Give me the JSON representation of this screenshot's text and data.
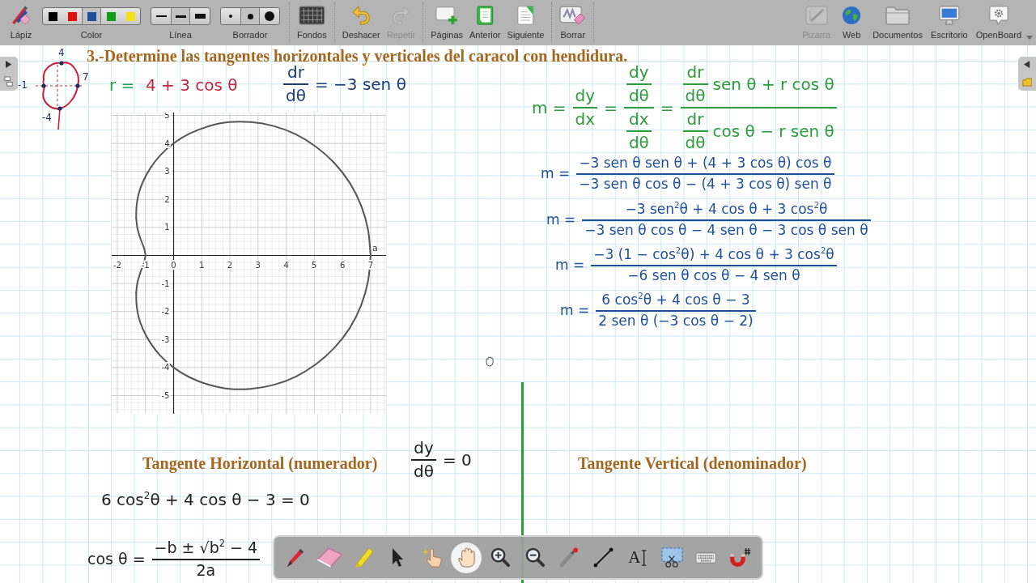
{
  "toolbar": {
    "left": [
      {
        "kind": "tool",
        "label": "Lápiz",
        "disabled": false
      },
      {
        "kind": "colors",
        "label": "Color",
        "disabled": false,
        "swatches": [
          {
            "color": "#000000",
            "selected": false
          },
          {
            "color": "#e01010",
            "selected": false
          },
          {
            "color": "#1f4f9a",
            "selected": true
          },
          {
            "color": "#159c1a",
            "selected": false
          },
          {
            "color": "#f2e21a",
            "selected": false
          }
        ]
      },
      {
        "kind": "widths",
        "label": "Línea",
        "disabled": false,
        "options": [
          {
            "selected": false
          },
          {
            "selected": true
          },
          {
            "selected": false
          }
        ]
      },
      {
        "kind": "erasers",
        "label": "Borrador",
        "disabled": false,
        "options": [
          {
            "selected": false
          },
          {
            "selected": true
          },
          {
            "selected": false
          }
        ]
      },
      {
        "kind": "tool",
        "label": "Fondos",
        "disabled": false
      },
      {
        "kind": "tool",
        "label": "Deshacer",
        "disabled": false
      },
      {
        "kind": "tool",
        "label": "Repetir",
        "disabled": true
      },
      {
        "kind": "tool",
        "label": "Páginas",
        "disabled": false
      },
      {
        "kind": "tool",
        "label": "Anterior",
        "disabled": false
      },
      {
        "kind": "tool",
        "label": "Siguiente",
        "disabled": false
      },
      {
        "kind": "tool",
        "label": "Borrar",
        "disabled": false
      }
    ],
    "right": [
      {
        "label": "Pizarra",
        "disabled": true
      },
      {
        "label": "Web",
        "disabled": false
      },
      {
        "label": "Documentos",
        "disabled": false
      },
      {
        "label": "Escritorio",
        "disabled": false
      },
      {
        "label": "OpenBoard",
        "disabled": false
      }
    ]
  },
  "board": {
    "title": "3.-Determine las tangentes horizontales y verticales del caracol con hendidura.",
    "sketch": {
      "labels": [
        "4",
        "-1",
        "7",
        "-4"
      ]
    },
    "equations": [
      {
        "color": "#23a24b",
        "parts": [
          {
            "kind": "text",
            "text": "r ="
          }
        ]
      },
      {
        "color": "#c4243c",
        "parts": [
          {
            "kind": "text",
            "text": "4 + 3 cos θ"
          }
        ]
      },
      {
        "color": "#1c3d7a",
        "parts": [
          {
            "kind": "fraction",
            "num": [
              {
                "kind": "text",
                "text": "dr"
              }
            ],
            "den": [
              {
                "kind": "text",
                "text": "dθ"
              }
            ]
          },
          {
            "kind": "text",
            "text": "= −3 sen θ"
          }
        ]
      },
      {
        "color": "#2e9b3c",
        "parts": [
          {
            "kind": "text",
            "text": "m ="
          },
          {
            "kind": "fraction",
            "num": [
              {
                "kind": "text",
                "text": "dy"
              }
            ],
            "den": [
              {
                "kind": "text",
                "text": "dx"
              }
            ]
          },
          {
            "kind": "text",
            "text": "="
          },
          {
            "kind": "fraction",
            "num": [
              {
                "kind": "fraction",
                "num": [
                  {
                    "kind": "text",
                    "text": "dy"
                  }
                ],
                "den": [
                  {
                    "kind": "text",
                    "text": "dθ"
                  }
                ]
              }
            ],
            "den": [
              {
                "kind": "fraction",
                "num": [
                  {
                    "kind": "text",
                    "text": "dx"
                  }
                ],
                "den": [
                  {
                    "kind": "text",
                    "text": "dθ"
                  }
                ]
              }
            ]
          },
          {
            "kind": "text",
            "text": "="
          },
          {
            "kind": "fraction",
            "num": [
              {
                "kind": "fraction",
                "num": [
                  {
                    "kind": "text",
                    "text": "dr"
                  }
                ],
                "den": [
                  {
                    "kind": "text",
                    "text": "dθ"
                  }
                ]
              },
              {
                "kind": "text",
                "text": "sen θ + r cos θ"
              }
            ],
            "den": [
              {
                "kind": "fraction",
                "num": [
                  {
                    "kind": "text",
                    "text": "dr"
                  }
                ],
                "den": [
                  {
                    "kind": "text",
                    "text": "dθ"
                  }
                ]
              },
              {
                "kind": "text",
                "text": "cos θ − r sen θ"
              }
            ]
          }
        ]
      },
      {
        "color": "#1f4f96",
        "parts": [
          {
            "kind": "text",
            "text": "m ="
          },
          {
            "kind": "fraction",
            "num": [
              {
                "kind": "text",
                "text": "−3 sen θ sen θ + (4 + 3 cos θ) cos θ"
              }
            ],
            "den": [
              {
                "kind": "text",
                "text": "−3 sen θ cos θ − (4 + 3 cos θ) sen θ"
              }
            ]
          }
        ]
      },
      {
        "color": "#1f4f96",
        "parts": [
          {
            "kind": "text",
            "text": "m ="
          },
          {
            "kind": "fraction",
            "num": [
              {
                "kind": "text",
                "text": "−3 sen$^{2}$θ + 4 cos θ + 3 cos$^{2}$θ"
              }
            ],
            "den": [
              {
                "kind": "text",
                "text": "−3 sen θ cos θ − 4 sen θ − 3 cos θ sen θ"
              }
            ]
          }
        ]
      },
      {
        "color": "#1f4f96",
        "parts": [
          {
            "kind": "text",
            "text": "m ="
          },
          {
            "kind": "fraction",
            "num": [
              {
                "kind": "text",
                "text": "−3 (1 − cos$^{2}$θ) + 4 cos θ + 3 cos$^{2}$θ"
              }
            ],
            "den": [
              {
                "kind": "text",
                "text": "−6 sen θ cos θ − 4 sen θ"
              }
            ]
          }
        ]
      },
      {
        "color": "#1f4f96",
        "parts": [
          {
            "kind": "text",
            "text": "m ="
          },
          {
            "kind": "fraction",
            "num": [
              {
                "kind": "text",
                "text": "6 cos$^{2}$θ + 4 cos θ − 3"
              }
            ],
            "den": [
              {
                "kind": "text",
                "text": "2 sen θ (−3 cos θ − 2)"
              }
            ]
          }
        ]
      },
      {
        "color": "#222222",
        "parts": [
          {
            "kind": "fraction",
            "num": [
              {
                "kind": "text",
                "text": "dy"
              }
            ],
            "den": [
              {
                "kind": "text",
                "text": "dθ"
              }
            ]
          },
          {
            "kind": "text",
            "text": "= 0"
          }
        ]
      },
      {
        "color": "#222222",
        "parts": [
          {
            "kind": "text",
            "text": "6 cos$^{2}$θ + 4 cos θ − 3 = 0"
          }
        ]
      },
      {
        "color": "#222222",
        "parts": [
          {
            "kind": "text",
            "text": "cos θ ="
          },
          {
            "kind": "fraction",
            "num": [
              {
                "kind": "text",
                "text": "−b ± √b$^{2}$ − 4"
              }
            ],
            "den": [
              {
                "kind": "text",
                "text": "2a"
              }
            ]
          }
        ]
      }
    ],
    "graph": {
      "chart_data": {
        "type": "line",
        "series": [
          {
            "color": "#555555",
            "x": [
              -1.33,
              -1.32,
              -1.25,
              -1.09,
              -0.83,
              -0.47,
              0,
              0.57,
              1.24,
              1.97,
              2.75,
              3.55,
              4.33,
              5.06,
              5.71,
              6.26,
              6.66,
              6.91,
              7
            ],
            "values": [
              1.33,
              1.72,
              2.17,
              2.63,
              3.11,
              3.58,
              4,
              4.35,
              4.61,
              4.76,
              4.76,
              4.62,
              4.33,
              3.88,
              3.3,
              2.59,
              1.79,
              0.91,
              0
            ]
          },
          {
            "color": "#555555",
            "x": [
              -1.33,
              -1.29,
              -1.21,
              -1.13,
              -1.06,
              -1.02,
              -1
            ],
            "values": [
              1.33,
              0.99,
              0.7,
              0.47,
              0.29,
              0.13,
              0
            ]
          },
          {
            "color": "#555555",
            "x": [
              -1.33,
              -1.29,
              -1.21,
              -1.13,
              -1.06,
              -1.02,
              -1
            ],
            "values": [
              -1.33,
              -0.99,
              -0.7,
              -0.47,
              -0.29,
              -0.13,
              0
            ]
          },
          {
            "color": "#555555",
            "x": [
              -1.33,
              -1.32,
              -1.25,
              -1.09,
              -0.83,
              -0.47,
              0,
              0.57,
              1.24,
              1.97,
              2.75,
              3.55,
              4.33,
              5.06,
              5.71,
              6.26,
              6.66,
              6.91,
              7
            ],
            "values": [
              -1.33,
              -1.72,
              -2.17,
              -2.63,
              -3.11,
              -3.58,
              -4,
              -4.35,
              -4.61,
              -4.76,
              -4.76,
              -4.62,
              -4.33,
              -3.88,
              -3.3,
              -2.59,
              -1.79,
              -0.91,
              0
            ]
          }
        ],
        "xlim": [
          -2.2,
          7.55
        ],
        "ylim": [
          -5.65,
          5.1
        ],
        "xticks": [
          -2,
          -1,
          0,
          1,
          2,
          3,
          4,
          5,
          6,
          7
        ],
        "yticks": [
          -5,
          -4,
          -3,
          -2,
          -1,
          1,
          2,
          3,
          4,
          5
        ],
        "grid": true,
        "annotations": [
          "a"
        ]
      }
    },
    "headings": [
      "Tangente Horizontal (numerador)",
      "Tangente Vertical (denominador)"
    ]
  },
  "stylus_palette": {
    "tools": [
      {
        "selected": false
      },
      {
        "selected": false
      },
      {
        "selected": false
      },
      {
        "selected": false
      },
      {
        "selected": false
      },
      {
        "selected": true
      },
      {
        "selected": false
      },
      {
        "selected": false
      },
      {
        "selected": false
      },
      {
        "selected": false
      },
      {
        "selected": false,
        "text": "A"
      },
      {
        "selected": false
      },
      {
        "selected": false
      },
      {
        "selected": false
      }
    ]
  }
}
